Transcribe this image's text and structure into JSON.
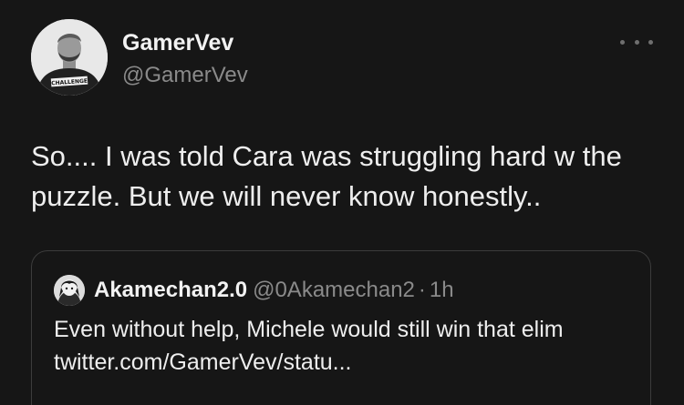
{
  "tweet": {
    "author": {
      "display_name": "GamerVev",
      "handle": "@GamerVev",
      "avatar_shirt_text": "CHALLENGE"
    },
    "more_icon": "more-horizontal-icon",
    "text": "So.... I was told Cara was struggling hard w the puzzle. But we will never know honestly..",
    "quoted": {
      "display_name": "Akamechan2.0",
      "handle": "@0Akamechan2",
      "separator": "·",
      "time": "1h",
      "text": "Even without help, Michele would still win that elim twitter.com/GamerVev/statu..."
    }
  },
  "colors": {
    "background": "#161616",
    "primary_text": "#eeeeee",
    "secondary_text": "#8a8a8a",
    "border": "#3c3c3c"
  }
}
